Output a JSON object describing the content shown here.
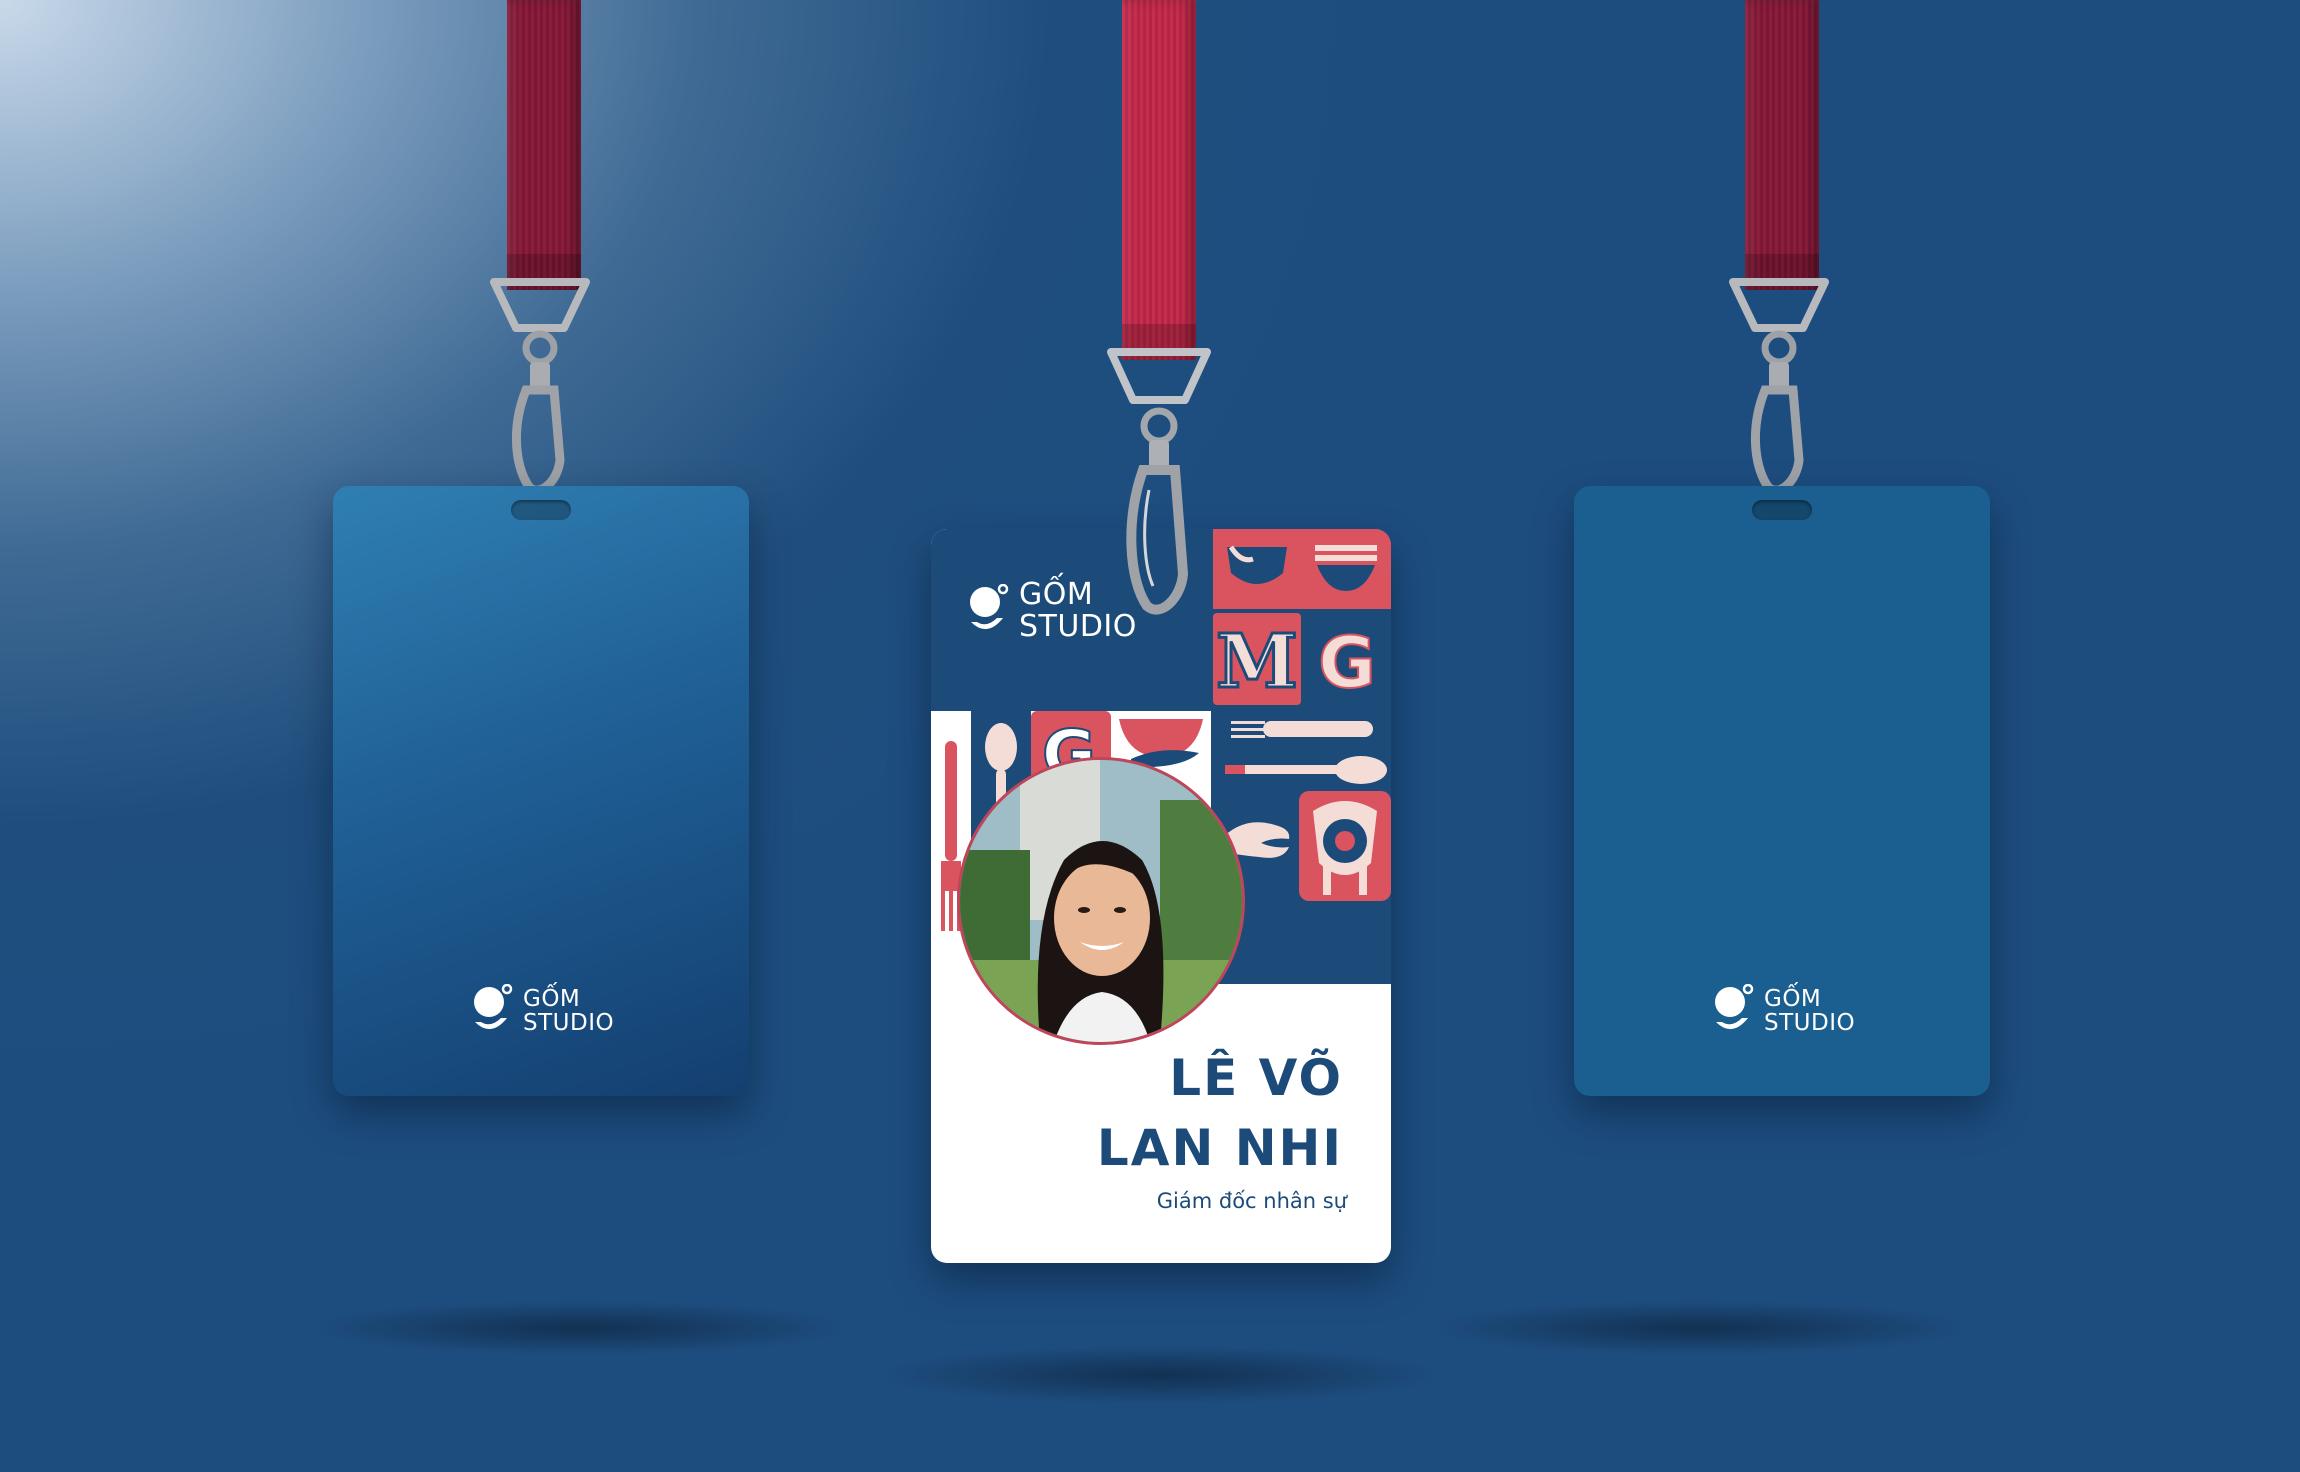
{
  "brand": {
    "logo_line1": "GỐM",
    "logo_line2": "STUDIO"
  },
  "badge": {
    "name_line1": "LÊ VÕ",
    "name_line2": "LAN NHI",
    "role": "Giám đốc nhân sự"
  },
  "colors": {
    "navy": "#1c4b7a",
    "red": "#d9545f",
    "cream": "#f4ddd6",
    "lanyard": "#c62d4e"
  },
  "icons": [
    "clip-icon",
    "spoon-icon",
    "fork-icon",
    "bowl-icon",
    "hand-icon",
    "letter-tile"
  ]
}
